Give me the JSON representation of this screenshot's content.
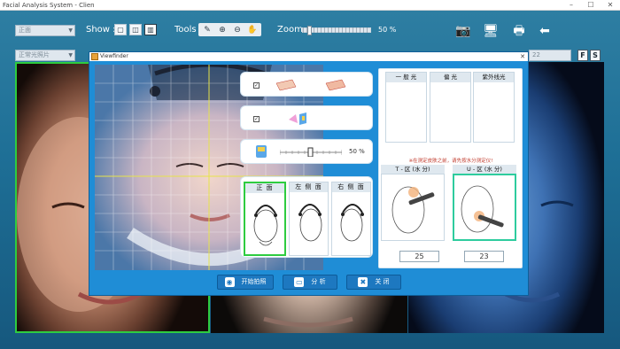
{
  "window": {
    "title": "Facial Analysis System - Clien",
    "min": "–",
    "max": "☐",
    "close": "✕"
  },
  "toolbar": {
    "view_combo": "正面",
    "show_label": "Show :",
    "tools_label": "Tools :",
    "zoom_label": "Zoom :",
    "zoom_value": "50 %"
  },
  "panels": {
    "p1_combo": "正常光照片",
    "p3_combo": "22",
    "f_button": "F",
    "s_button": "S"
  },
  "viewfinder": {
    "title": "Viewfinder",
    "brightness_value": "50 %",
    "angles": [
      {
        "label": "正 面"
      },
      {
        "label": "左 侧 面"
      },
      {
        "label": "右 侧 面"
      }
    ],
    "light_headers": [
      "一 般 光",
      "偏 光",
      "紫外线光"
    ],
    "warning": "※在测定皮肤之前，请先按水分测定仪!",
    "t_zone_label": "T - 区 (水 分)",
    "u_zone_label": "U - 区 (水 分)",
    "t_zone_value": "25",
    "u_zone_value": "23",
    "buttons": {
      "capture": "开始拍照",
      "analyze": "分    析",
      "close": "关    闭"
    }
  },
  "colors": {
    "selected_border": "#2ecc40",
    "dialog_bg": "#1f8dd6",
    "warning": "#c0392b"
  }
}
